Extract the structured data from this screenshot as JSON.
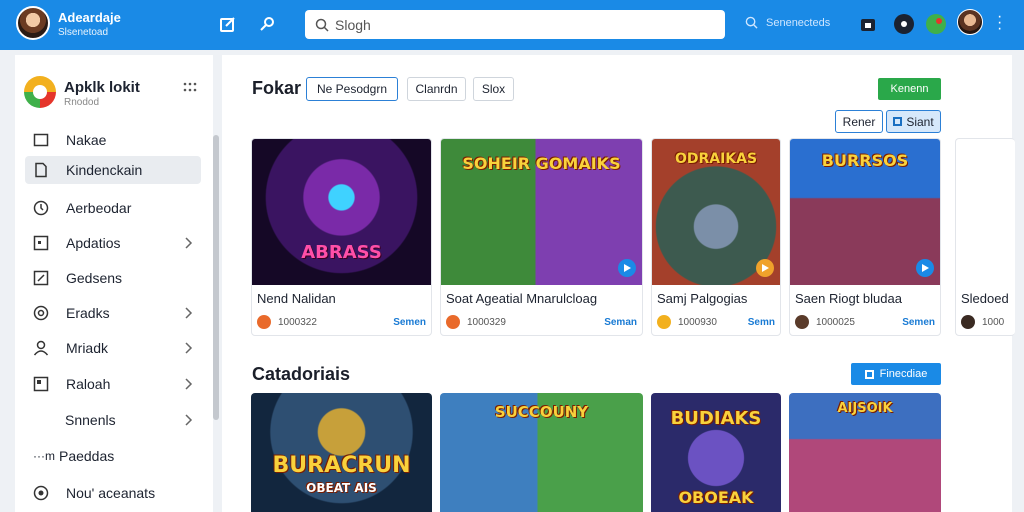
{
  "topbar": {
    "brand_title": "Adeardaje",
    "brand_sub": "Slsenetoad",
    "search_placeholder": "Slogh",
    "secondary_search": "Senenecteds"
  },
  "sidebar": {
    "app_name": "Apklk lokit",
    "app_sub": "Rnodod",
    "items": [
      {
        "label": "Nakae",
        "icon": "folder-icon"
      },
      {
        "label": "Kindenckain",
        "icon": "document-icon"
      },
      {
        "label": "Aerbeodar",
        "icon": "clock-icon"
      },
      {
        "label": "Apdatios",
        "icon": "square-icon"
      },
      {
        "label": "Gedsens",
        "icon": "edit-icon"
      },
      {
        "label": "Eradks",
        "icon": "gear-icon"
      },
      {
        "label": "Mriadk",
        "icon": "user-icon"
      },
      {
        "label": "Raloah",
        "icon": "box-icon"
      },
      {
        "label": "Snnenls",
        "icon": ""
      },
      {
        "label": "Paeddas",
        "prefix": "···m"
      },
      {
        "label": "Nou' aceanats",
        "icon": "settings-icon"
      }
    ]
  },
  "main": {
    "section1_title": "Fokar",
    "chips": [
      "Ne Pesodgrn",
      "Clanrdn",
      "Slox"
    ],
    "green_button": "Kenenn",
    "btn_filter1": "Rener",
    "btn_filter2": "Siant",
    "cards": [
      {
        "title": "Nend Nalidan",
        "count": "1000322",
        "link": "Semen",
        "art_text": "ABRASS"
      },
      {
        "title": "Soat Ageatial Mnarulcloag",
        "count": "1000329",
        "link": "Seman",
        "art_text": "SOHEIR GOMAIKS"
      },
      {
        "title": "Samj Palgogias",
        "count": "1000930",
        "link": "Semn",
        "art_text": "ODRAIKAS"
      },
      {
        "title": "Saen Riogt bludaa",
        "count": "1000025",
        "link": "Semen",
        "art_text": "BURRSOS"
      },
      {
        "title": "Sledoed",
        "count": "1000",
        "link": ""
      }
    ],
    "section2_title": "Catadoriais",
    "blue_button": "Finecdiae",
    "cards2": [
      {
        "art_text": "BURACRUN",
        "art_sub": "OBEAT AIS"
      },
      {
        "art_text": "SUCCOUNY"
      },
      {
        "art_text": "BUDIAKS",
        "art_sub": "OBOEAK"
      },
      {
        "art_text": "AIJSOIK"
      }
    ]
  }
}
